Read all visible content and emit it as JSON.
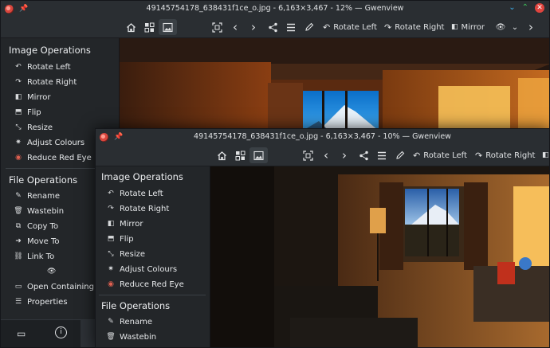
{
  "window_back": {
    "title": "49145754178_638431f1ce_o.jpg - 6,163×3,467 - 12% — Gwenview",
    "toolbar": {
      "rotate_left": "Rotate Left",
      "rotate_right": "Rotate Right",
      "mirror": "Mirror"
    },
    "sidebar": {
      "image_ops_title": "Image Operations",
      "image_ops": [
        "Rotate Left",
        "Rotate Right",
        "Mirror",
        "Flip",
        "Resize",
        "Adjust Colours",
        "Reduce Red Eye"
      ],
      "file_ops_title": "File Operations",
      "file_ops": [
        "Rename",
        "Wastebin",
        "Copy To",
        "Move To",
        "Link To"
      ],
      "extra": [
        "Open Containing Fold",
        "Properties"
      ]
    }
  },
  "window_front": {
    "title": "49145754178_638431f1ce_o.jpg - 6,163×3,467 - 10% — Gwenview",
    "toolbar": {
      "rotate_left": "Rotate Left",
      "rotate_right": "Rotate Right"
    },
    "sidebar": {
      "image_ops_title": "Image Operations",
      "image_ops": [
        "Rotate Left",
        "Rotate Right",
        "Mirror",
        "Flip",
        "Resize",
        "Adjust Colours",
        "Reduce Red Eye"
      ],
      "file_ops_title": "File Operations",
      "file_ops": [
        "Rename",
        "Wastebin"
      ]
    }
  },
  "icons": {
    "sidebar_image_ops": [
      "rotate-left-icon",
      "rotate-right-icon",
      "mirror-icon",
      "flip-icon",
      "resize-icon",
      "adjust-colours-icon",
      "red-eye-icon"
    ],
    "sidebar_file_ops": [
      "rename-icon",
      "wastebin-icon",
      "copy-icon",
      "move-icon",
      "link-icon"
    ]
  },
  "colors": {
    "window_bg": "#232629",
    "titlebar_bg": "#2a2e32",
    "text": "#e4e6e8",
    "close_red": "#e0443e",
    "accent_green": "#3ec75b"
  }
}
